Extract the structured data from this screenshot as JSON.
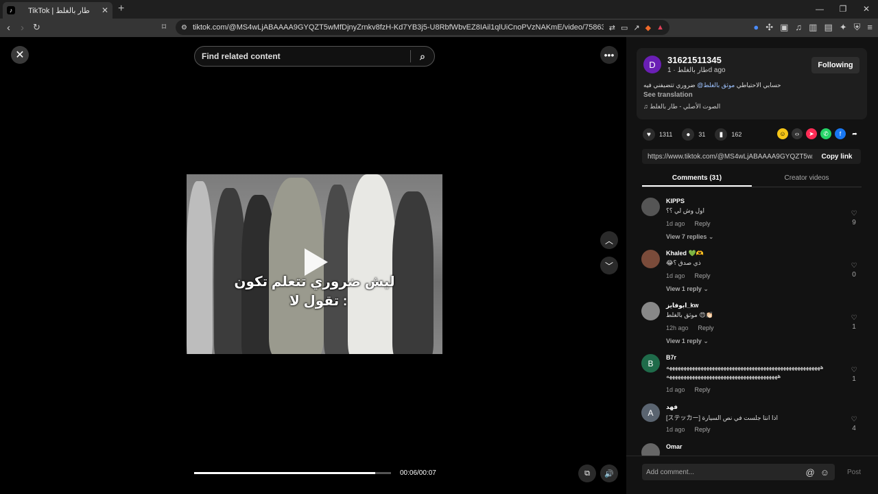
{
  "browser": {
    "tab_title": "TikTok | طار بالغلط",
    "tab_favicon": "tiktok-logo",
    "new_tab": "+",
    "url": "tiktok.com/@MS4wLjABAAAA9GYQZT5wMfDjnyZrnkv8fzH-Kd7YB3j5-U8RbfWbvEZ8IAil1qlUiCnoPVzNAKmE/video/7586362853502831893..."
  },
  "video": {
    "search_placeholder": "Find related content",
    "caption_line1": "ليش ضروري تتعلم تكون",
    "caption_line2": "تقول لا :",
    "time": "00:06/00:07",
    "progress_fraction": 0.92
  },
  "author": {
    "avatar_letter": "D",
    "avatar_color": "#6a1fb5",
    "username": "31621511345",
    "subline": "طار بالغلط · 1d ago",
    "follow_label": "Following",
    "description_pre": "حسابي الاحتياطي ",
    "description_mention": "موثق بالغلط@",
    "description_post": " ضروري تتضيفني فيه",
    "see_translation": "See translation",
    "music": "♫ الصوت الأصلي - طار بالغلط"
  },
  "stats": {
    "likes": "1311",
    "comments": "31",
    "saves": "162"
  },
  "share": {
    "link": "https://www.tiktok.com/@MS4wLjABAAAA9GYQZT5w...",
    "copy_label": "Copy link"
  },
  "tabs": {
    "comments": "Comments (31)",
    "creator": "Creator videos"
  },
  "comments": [
    {
      "name": "KIPPS",
      "text": "اول وش لي ؟؟",
      "time": "1d ago",
      "reply": "Reply",
      "likes": "9",
      "view": "View 7 replies ⌄",
      "avatar": "",
      "color": "#555"
    },
    {
      "name": "Khaled 💚🫶",
      "text": "😂ذي صدق ؟",
      "time": "1d ago",
      "reply": "Reply",
      "likes": "0",
      "view": "View 1 reply ⌄",
      "avatar": "",
      "color": "#7a4b3a"
    },
    {
      "name": "ابوفايز_kw",
      "text": "موثق بالغلط 😍👏🏻",
      "time": "12h ago",
      "reply": "Reply",
      "likes": "1",
      "view": "View 1 reply ⌄",
      "avatar": "",
      "color": "#888"
    },
    {
      "name": "B7r",
      "text": "ههههههههههههههههههههههههههههههههههههههههههههههههههههههه",
      "text2": "هههههههههههههههههههههههههههههههههههههههه",
      "time": "1d ago",
      "reply": "Reply",
      "likes": "1",
      "avatar": "B",
      "color": "#1f6b4a"
    },
    {
      "name": "فهد",
      "text": "[ステッカー] اذا انتا جلست في نص السيارة",
      "time": "1d ago",
      "reply": "Reply",
      "likes": "4",
      "avatar": "A",
      "color": "#5a6470"
    },
    {
      "name": "Omar",
      "avatar": "",
      "color": "#666"
    }
  ],
  "compose": {
    "placeholder": "Add comment...",
    "post": "Post"
  }
}
